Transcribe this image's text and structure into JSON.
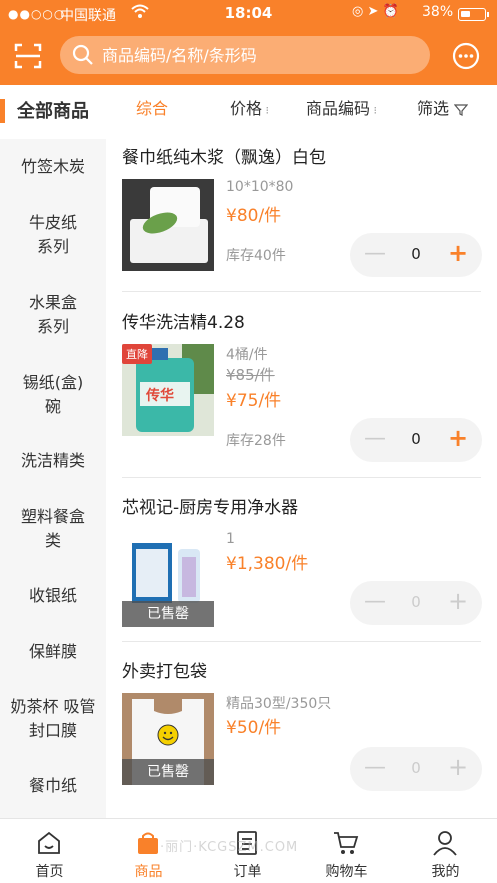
{
  "status_bar": {
    "signal": "●●○○○",
    "carrier": "中国联通",
    "time": "18:04",
    "battery": "38%"
  },
  "header": {
    "search_placeholder": "商品编码/名称/条形码",
    "scan_icon": "scan-icon",
    "chat_icon": "chat-bubble-icon",
    "accent_color": "#f9812a"
  },
  "sidebar": {
    "items": [
      {
        "label": "全部商品",
        "active": true
      },
      {
        "label": "竹签木炭"
      },
      {
        "label": "牛皮纸系列"
      },
      {
        "label": "水果盒系列"
      },
      {
        "label": "锡纸(盒)碗"
      },
      {
        "label": "洗洁精类"
      },
      {
        "label": "塑料餐盒类"
      },
      {
        "label": "收银纸"
      },
      {
        "label": "保鲜膜"
      },
      {
        "label": "奶茶杯 吸管 封口膜"
      },
      {
        "label": "餐巾纸"
      }
    ]
  },
  "filters": {
    "comprehensive": "综合",
    "price": "价格",
    "code": "商品编码",
    "filter": "筛选"
  },
  "products": [
    {
      "name": "餐巾纸纯木浆（飘逸）白包",
      "spec": "10*10*80",
      "price": "¥80/件",
      "stock": "库存40件",
      "qty": "0"
    },
    {
      "name": "传华洗洁精4.28",
      "badge": "直降",
      "spec": "4桶/件",
      "old_price": "¥85/件",
      "price": "¥75/件",
      "stock": "库存28件",
      "qty": "0"
    },
    {
      "name": "芯视记-厨房专用净水器",
      "spec": "1",
      "price": "¥1,380/件",
      "sold_out": "已售罄",
      "qty": "0"
    },
    {
      "name": "外卖打包袋",
      "spec": "精品30型/350只",
      "price": "¥50/件",
      "sold_out": "已售罄",
      "qty": "0"
    }
  ],
  "tabbar": {
    "home": "首页",
    "products": "商品",
    "orders": "订单",
    "cart": "购物车",
    "mine": "我的"
  },
  "watermark": "·丽门·KCGSZM.COM"
}
